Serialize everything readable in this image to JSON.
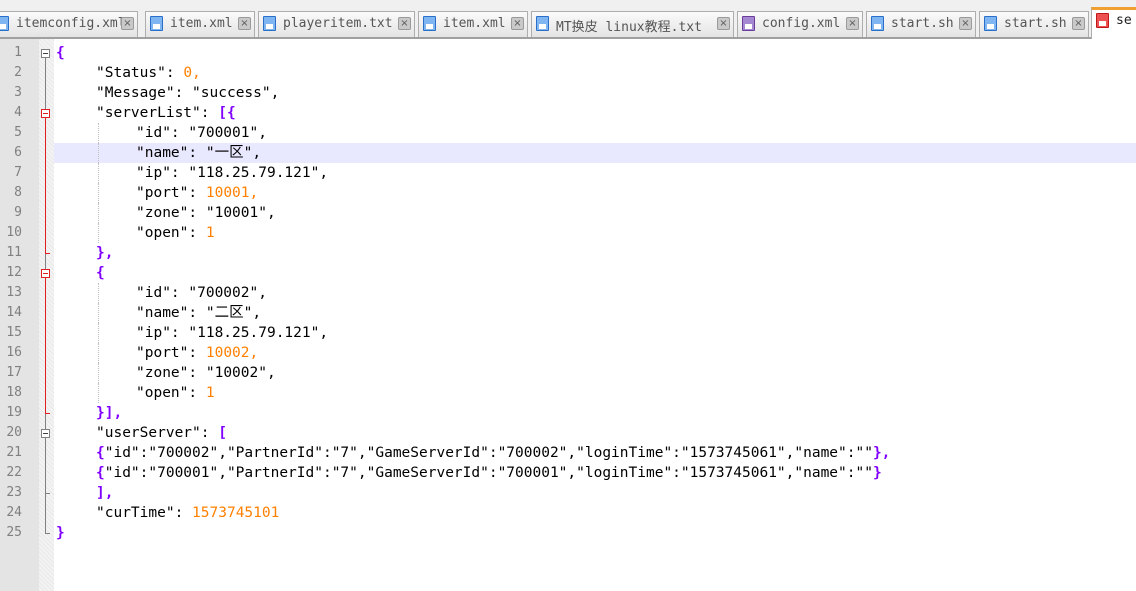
{
  "tabs": [
    {
      "label": "itemconfig.xml",
      "icon": "file-icon",
      "active": false
    },
    {
      "label": "item.xml",
      "icon": "file-icon",
      "active": false
    },
    {
      "label": "playeritem.txt",
      "icon": "file-icon",
      "active": false
    },
    {
      "label": "item.xml",
      "icon": "file-icon",
      "active": false
    },
    {
      "label": "MT换皮 linux教程.txt",
      "icon": "file-icon",
      "active": false
    },
    {
      "label": "config.xml",
      "icon": "file-modified-icon",
      "active": false
    },
    {
      "label": "start.sh",
      "icon": "file-icon",
      "active": false
    },
    {
      "label": "start.sh",
      "icon": "file-icon",
      "active": false
    },
    {
      "label": "se",
      "icon": "file-unsaved-icon",
      "active": true
    }
  ],
  "close_glyph": "×",
  "editor": {
    "current_line": 6,
    "lines": [
      {
        "n": "1",
        "indent": 0,
        "tokens": [
          {
            "t": "{",
            "c": "op"
          }
        ]
      },
      {
        "n": "2",
        "indent": 1,
        "tokens": [
          {
            "t": "\"Status\"",
            "c": "str"
          },
          {
            "t": ": ",
            "c": "str"
          },
          {
            "t": "0",
            "c": "num"
          },
          {
            "t": ",",
            "c": "num"
          }
        ]
      },
      {
        "n": "3",
        "indent": 1,
        "tokens": [
          {
            "t": "\"Message\"",
            "c": "str"
          },
          {
            "t": ": ",
            "c": "str"
          },
          {
            "t": "\"success\"",
            "c": "str"
          },
          {
            "t": ",",
            "c": "str"
          }
        ]
      },
      {
        "n": "4",
        "indent": 1,
        "tokens": [
          {
            "t": "\"serverList\"",
            "c": "str"
          },
          {
            "t": ": ",
            "c": "str"
          },
          {
            "t": "[{",
            "c": "op"
          }
        ]
      },
      {
        "n": "5",
        "indent": 2,
        "tokens": [
          {
            "t": "\"id\"",
            "c": "str"
          },
          {
            "t": ": ",
            "c": "str"
          },
          {
            "t": "\"700001\"",
            "c": "str"
          },
          {
            "t": ",",
            "c": "str"
          }
        ]
      },
      {
        "n": "6",
        "indent": 2,
        "tokens": [
          {
            "t": "\"name\"",
            "c": "str"
          },
          {
            "t": ": ",
            "c": "str"
          },
          {
            "t": "\"一区\"",
            "c": "str"
          },
          {
            "t": ",",
            "c": "str"
          }
        ]
      },
      {
        "n": "7",
        "indent": 2,
        "tokens": [
          {
            "t": "\"ip\"",
            "c": "str"
          },
          {
            "t": ": ",
            "c": "str"
          },
          {
            "t": "\"118.25.79.121\"",
            "c": "str"
          },
          {
            "t": ",",
            "c": "str"
          }
        ]
      },
      {
        "n": "8",
        "indent": 2,
        "tokens": [
          {
            "t": "\"port\"",
            "c": "str"
          },
          {
            "t": ": ",
            "c": "str"
          },
          {
            "t": "10001",
            "c": "num"
          },
          {
            "t": ",",
            "c": "num"
          }
        ]
      },
      {
        "n": "9",
        "indent": 2,
        "tokens": [
          {
            "t": "\"zone\"",
            "c": "str"
          },
          {
            "t": ": ",
            "c": "str"
          },
          {
            "t": "\"10001\"",
            "c": "str"
          },
          {
            "t": ",",
            "c": "str"
          }
        ]
      },
      {
        "n": "10",
        "indent": 2,
        "tokens": [
          {
            "t": "\"open\"",
            "c": "str"
          },
          {
            "t": ": ",
            "c": "str"
          },
          {
            "t": "1",
            "c": "num"
          }
        ]
      },
      {
        "n": "11",
        "indent": 1,
        "tokens": [
          {
            "t": "},",
            "c": "op"
          }
        ]
      },
      {
        "n": "12",
        "indent": 1,
        "tokens": [
          {
            "t": "{",
            "c": "op"
          }
        ]
      },
      {
        "n": "13",
        "indent": 2,
        "tokens": [
          {
            "t": "\"id\"",
            "c": "str"
          },
          {
            "t": ": ",
            "c": "str"
          },
          {
            "t": "\"700002\"",
            "c": "str"
          },
          {
            "t": ",",
            "c": "str"
          }
        ]
      },
      {
        "n": "14",
        "indent": 2,
        "tokens": [
          {
            "t": "\"name\"",
            "c": "str"
          },
          {
            "t": ": ",
            "c": "str"
          },
          {
            "t": "\"二区\"",
            "c": "str"
          },
          {
            "t": ",",
            "c": "str"
          }
        ]
      },
      {
        "n": "15",
        "indent": 2,
        "tokens": [
          {
            "t": "\"ip\"",
            "c": "str"
          },
          {
            "t": ": ",
            "c": "str"
          },
          {
            "t": "\"118.25.79.121\"",
            "c": "str"
          },
          {
            "t": ",",
            "c": "str"
          }
        ]
      },
      {
        "n": "16",
        "indent": 2,
        "tokens": [
          {
            "t": "\"port\"",
            "c": "str"
          },
          {
            "t": ": ",
            "c": "str"
          },
          {
            "t": "10002",
            "c": "num"
          },
          {
            "t": ",",
            "c": "num"
          }
        ]
      },
      {
        "n": "17",
        "indent": 2,
        "tokens": [
          {
            "t": "\"zone\"",
            "c": "str"
          },
          {
            "t": ": ",
            "c": "str"
          },
          {
            "t": "\"10002\"",
            "c": "str"
          },
          {
            "t": ",",
            "c": "str"
          }
        ]
      },
      {
        "n": "18",
        "indent": 2,
        "tokens": [
          {
            "t": "\"open\"",
            "c": "str"
          },
          {
            "t": ": ",
            "c": "str"
          },
          {
            "t": "1",
            "c": "num"
          }
        ]
      },
      {
        "n": "19",
        "indent": 1,
        "tokens": [
          {
            "t": "}],",
            "c": "op"
          }
        ]
      },
      {
        "n": "20",
        "indent": 1,
        "tokens": [
          {
            "t": "\"userServer\"",
            "c": "str"
          },
          {
            "t": ": ",
            "c": "str"
          },
          {
            "t": "[",
            "c": "op"
          }
        ]
      },
      {
        "n": "21",
        "indent": 1,
        "tokens": [
          {
            "t": "{",
            "c": "op"
          },
          {
            "t": "\"id\":\"700002\",\"PartnerId\":\"7\",\"GameServerId\":\"700002\",\"loginTime\":\"1573745061\",\"name\":\"\"",
            "c": "str"
          },
          {
            "t": "},",
            "c": "op"
          }
        ]
      },
      {
        "n": "22",
        "indent": 1,
        "tokens": [
          {
            "t": "{",
            "c": "op"
          },
          {
            "t": "\"id\":\"700001\",\"PartnerId\":\"7\",\"GameServerId\":\"700001\",\"loginTime\":\"1573745061\",\"name\":\"\"",
            "c": "str"
          },
          {
            "t": "}",
            "c": "op"
          }
        ]
      },
      {
        "n": "23",
        "indent": 1,
        "tokens": [
          {
            "t": "],",
            "c": "op"
          }
        ]
      },
      {
        "n": "24",
        "indent": 1,
        "tokens": [
          {
            "t": "\"curTime\"",
            "c": "str"
          },
          {
            "t": ": ",
            "c": "str"
          },
          {
            "t": "1573745101",
            "c": "num"
          }
        ]
      },
      {
        "n": "25",
        "indent": 0,
        "tokens": [
          {
            "t": "}",
            "c": "op"
          }
        ]
      }
    ],
    "folds": [
      {
        "start": 1,
        "end": 25,
        "color": "gray"
      },
      {
        "start": 4,
        "end": 11,
        "color": "red"
      },
      {
        "start": 12,
        "end": 19,
        "color": "red"
      },
      {
        "start": 20,
        "end": 23,
        "color": "gray"
      }
    ]
  }
}
